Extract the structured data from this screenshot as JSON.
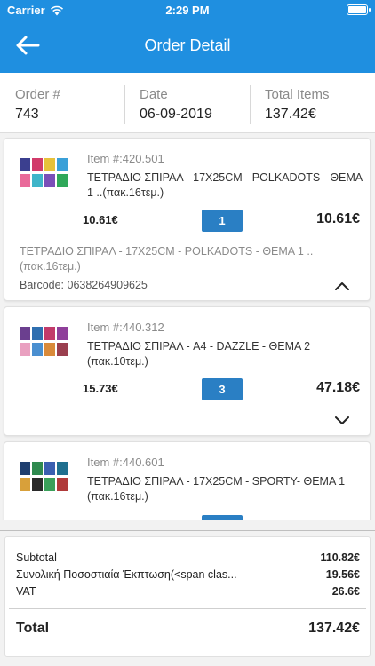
{
  "status": {
    "carrier": "Carrier",
    "time": "2:29 PM"
  },
  "nav": {
    "title": "Order Detail"
  },
  "summary": {
    "order_label": "Order #",
    "order_value": "743",
    "date_label": "Date",
    "date_value": "06-09-2019",
    "items_label": "Total Items",
    "items_value": "137.42€"
  },
  "items": [
    {
      "item_no": "Item #:420.501",
      "name": "ΤΕΤΡΑΔΙΟ ΣΠΙΡΑΛ - 17X25CM - POLKADOTS - ΘΕΜΑ 1 ..(πακ.16τεμ.)",
      "price": "10.61€",
      "qty": "1",
      "total": "10.61€",
      "desc": "ΤΕΤΡΑΔΙΟ ΣΠΙΡΑΛ - 17X25CM - POLKADOTS - ΘΕΜΑ 1 ..(πακ.16τεμ.)",
      "barcode": "Barcode: 0638264909625",
      "expanded": true
    },
    {
      "item_no": "Item #:440.312",
      "name": "ΤΕΤΡΑΔΙΟ ΣΠΙΡΑΛ - A4 - DAZZLE - ΘΕΜΑ 2 (πακ.10τεμ.)",
      "price": "15.73€",
      "qty": "3",
      "total": "47.18€",
      "expanded": false
    },
    {
      "item_no": "Item #:440.601",
      "name": "ΤΕΤΡΑΔΙΟ ΣΠΙΡΑΛ - 17X25CM - SPORTY- ΘΕΜΑ 1 (πακ.16τεμ.)",
      "expanded": false
    }
  ],
  "totals": {
    "subtotal_label": "Subtotal",
    "subtotal_value": "110.82€",
    "discount_label": "Συνολική Ποσοστιαία Έκπτωση(<span clas...",
    "discount_value": "19.56€",
    "vat_label": "VAT",
    "vat_value": "26.6€",
    "total_label": "Total",
    "total_value": "137.42€"
  },
  "colors": {
    "primary": "#1f8fe0",
    "qty_button": "#2a7fc4"
  },
  "icons": {
    "back": "arrow-left-icon",
    "expand": "chevron-up-icon",
    "collapse": "chevron-down-icon"
  }
}
